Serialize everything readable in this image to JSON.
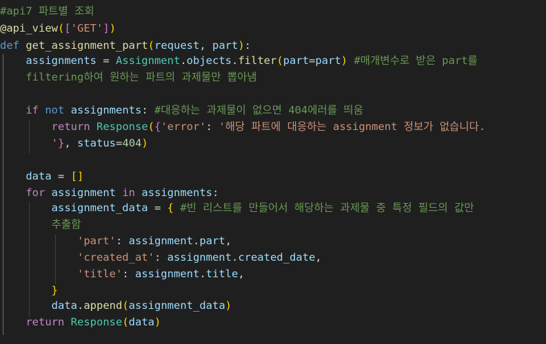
{
  "editor": {
    "theme_colors": {
      "background": "#1f1f1f",
      "comment": "#6a9955",
      "keyword": "#569cd6",
      "control": "#c586c0",
      "function": "#dcdcaa",
      "class": "#4ec9b0",
      "variable": "#9cdcfe",
      "string": "#ce9178",
      "number": "#b5cea8",
      "bracket_level_1": "#ffd700",
      "bracket_level_2": "#da70d6",
      "bracket_level_3": "#179fff"
    },
    "lines": [
      {
        "tokens": [
          {
            "t": "#api7 파트별 조회",
            "c": "comment"
          }
        ]
      },
      {
        "tokens": [
          {
            "t": "@api_view",
            "c": "function"
          },
          {
            "t": "(",
            "c": "bracket1"
          },
          {
            "t": "[",
            "c": "bracket2"
          },
          {
            "t": "'GET'",
            "c": "string"
          },
          {
            "t": "]",
            "c": "bracket2"
          },
          {
            "t": ")",
            "c": "bracket1"
          }
        ]
      },
      {
        "tokens": [
          {
            "t": "def",
            "c": "keyword"
          },
          {
            "t": " ",
            "c": "punct"
          },
          {
            "t": "get_assignment_part",
            "c": "function"
          },
          {
            "t": "(",
            "c": "bracket1"
          },
          {
            "t": "request",
            "c": "variable"
          },
          {
            "t": ", ",
            "c": "punct"
          },
          {
            "t": "part",
            "c": "variable"
          },
          {
            "t": ")",
            "c": "bracket1"
          },
          {
            "t": ":",
            "c": "punct"
          }
        ]
      },
      {
        "tokens": [
          {
            "t": "    ",
            "c": "punct"
          },
          {
            "t": "assignments",
            "c": "variable"
          },
          {
            "t": " = ",
            "c": "punct"
          },
          {
            "t": "Assignment",
            "c": "class"
          },
          {
            "t": ".",
            "c": "punct"
          },
          {
            "t": "objects",
            "c": "variable"
          },
          {
            "t": ".",
            "c": "punct"
          },
          {
            "t": "filter",
            "c": "function"
          },
          {
            "t": "(",
            "c": "bracket1"
          },
          {
            "t": "part",
            "c": "variable"
          },
          {
            "t": "=",
            "c": "punct"
          },
          {
            "t": "part",
            "c": "variable"
          },
          {
            "t": ")",
            "c": "bracket1"
          },
          {
            "t": " #매개변수로 받은 part를",
            "c": "comment"
          }
        ]
      },
      {
        "tokens": [
          {
            "t": "    ",
            "c": "punct"
          },
          {
            "t": "filtering하여 원하는 파트의 과제물만 뽑아냄",
            "c": "comment"
          }
        ]
      },
      {
        "tokens": []
      },
      {
        "tokens": [
          {
            "t": "    ",
            "c": "punct"
          },
          {
            "t": "if",
            "c": "control"
          },
          {
            "t": " ",
            "c": "punct"
          },
          {
            "t": "not",
            "c": "keyword"
          },
          {
            "t": " ",
            "c": "punct"
          },
          {
            "t": "assignments",
            "c": "variable"
          },
          {
            "t": ": ",
            "c": "punct"
          },
          {
            "t": "#대응하는 과제물이 없으면 404에러를 띄움",
            "c": "comment"
          }
        ]
      },
      {
        "tokens": [
          {
            "t": "        ",
            "c": "punct"
          },
          {
            "t": "return",
            "c": "control"
          },
          {
            "t": " ",
            "c": "punct"
          },
          {
            "t": "Response",
            "c": "class"
          },
          {
            "t": "(",
            "c": "bracket1"
          },
          {
            "t": "{",
            "c": "bracket2"
          },
          {
            "t": "'error'",
            "c": "string"
          },
          {
            "t": ": ",
            "c": "punct"
          },
          {
            "t": "'해당 파트에 대응하는 assignment 정보가 없습니다.",
            "c": "string"
          }
        ]
      },
      {
        "tokens": [
          {
            "t": "        ",
            "c": "punct"
          },
          {
            "t": "'",
            "c": "string"
          },
          {
            "t": "}",
            "c": "bracket2"
          },
          {
            "t": ", ",
            "c": "punct"
          },
          {
            "t": "status",
            "c": "variable"
          },
          {
            "t": "=",
            "c": "punct"
          },
          {
            "t": "404",
            "c": "number"
          },
          {
            "t": ")",
            "c": "bracket1"
          }
        ]
      },
      {
        "tokens": []
      },
      {
        "tokens": [
          {
            "t": "    ",
            "c": "punct"
          },
          {
            "t": "data",
            "c": "variable"
          },
          {
            "t": " = ",
            "c": "punct"
          },
          {
            "t": "[]",
            "c": "bracket1"
          }
        ]
      },
      {
        "tokens": [
          {
            "t": "    ",
            "c": "punct"
          },
          {
            "t": "for",
            "c": "control"
          },
          {
            "t": " ",
            "c": "punct"
          },
          {
            "t": "assignment",
            "c": "variable"
          },
          {
            "t": " ",
            "c": "punct"
          },
          {
            "t": "in",
            "c": "control"
          },
          {
            "t": " ",
            "c": "punct"
          },
          {
            "t": "assignments",
            "c": "variable"
          },
          {
            "t": ":",
            "c": "punct"
          }
        ]
      },
      {
        "tokens": [
          {
            "t": "        ",
            "c": "punct"
          },
          {
            "t": "assignment_data",
            "c": "variable"
          },
          {
            "t": " = ",
            "c": "punct"
          },
          {
            "t": "{",
            "c": "bracket1"
          },
          {
            "t": " #빈 리스트를 만들어서 해당하는 과제물 중 특정 필드의 값만",
            "c": "comment"
          }
        ]
      },
      {
        "tokens": [
          {
            "t": "        ",
            "c": "punct"
          },
          {
            "t": "추출함",
            "c": "comment"
          }
        ]
      },
      {
        "tokens": [
          {
            "t": "            ",
            "c": "punct"
          },
          {
            "t": "'part'",
            "c": "string"
          },
          {
            "t": ": ",
            "c": "punct"
          },
          {
            "t": "assignment",
            "c": "variable"
          },
          {
            "t": ".",
            "c": "punct"
          },
          {
            "t": "part",
            "c": "variable"
          },
          {
            "t": ",",
            "c": "punct"
          }
        ]
      },
      {
        "tokens": [
          {
            "t": "            ",
            "c": "punct"
          },
          {
            "t": "'created_at'",
            "c": "string"
          },
          {
            "t": ": ",
            "c": "punct"
          },
          {
            "t": "assignment",
            "c": "variable"
          },
          {
            "t": ".",
            "c": "punct"
          },
          {
            "t": "created_date",
            "c": "variable"
          },
          {
            "t": ",",
            "c": "punct"
          }
        ]
      },
      {
        "tokens": [
          {
            "t": "            ",
            "c": "punct"
          },
          {
            "t": "'title'",
            "c": "string"
          },
          {
            "t": ": ",
            "c": "punct"
          },
          {
            "t": "assignment",
            "c": "variable"
          },
          {
            "t": ".",
            "c": "punct"
          },
          {
            "t": "title",
            "c": "variable"
          },
          {
            "t": ",",
            "c": "punct"
          }
        ]
      },
      {
        "tokens": [
          {
            "t": "        ",
            "c": "punct"
          },
          {
            "t": "}",
            "c": "bracket1"
          }
        ]
      },
      {
        "tokens": [
          {
            "t": "        ",
            "c": "punct"
          },
          {
            "t": "data",
            "c": "variable"
          },
          {
            "t": ".",
            "c": "punct"
          },
          {
            "t": "append",
            "c": "function"
          },
          {
            "t": "(",
            "c": "bracket1"
          },
          {
            "t": "assignment_data",
            "c": "variable"
          },
          {
            "t": ")",
            "c": "bracket1"
          }
        ]
      },
      {
        "tokens": [
          {
            "t": "    ",
            "c": "punct"
          },
          {
            "t": "return",
            "c": "control"
          },
          {
            "t": " ",
            "c": "punct"
          },
          {
            "t": "Response",
            "c": "class"
          },
          {
            "t": "(",
            "c": "bracket1"
          },
          {
            "t": "data",
            "c": "variable"
          },
          {
            "t": ")",
            "c": "bracket1"
          }
        ]
      }
    ]
  }
}
